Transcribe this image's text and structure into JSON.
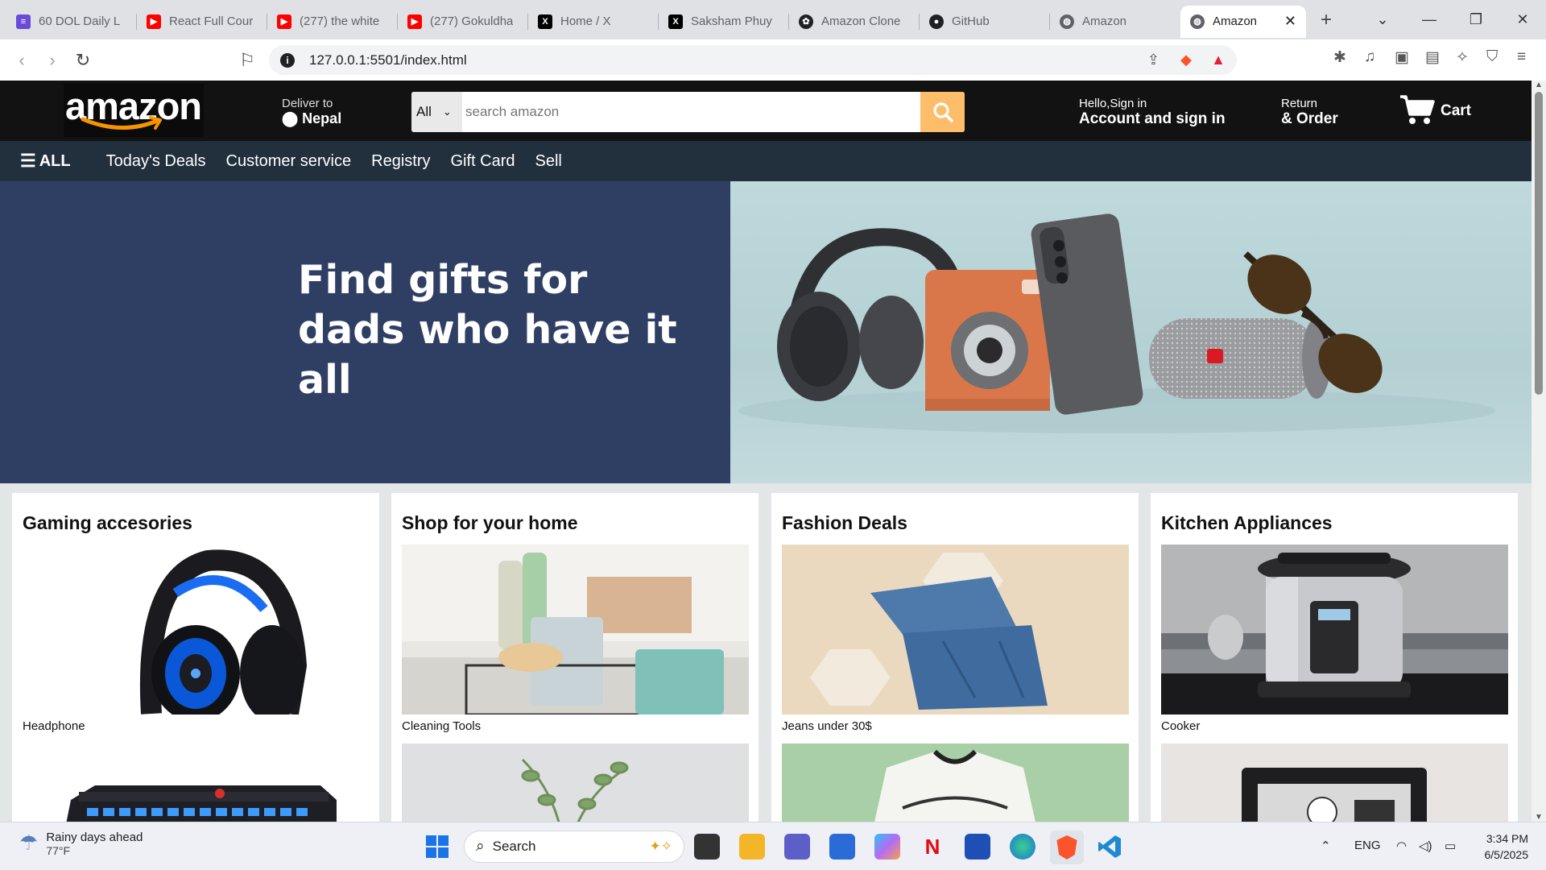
{
  "browser": {
    "tabs": [
      {
        "label": "60 DOL Daily L",
        "icon": "list-icon",
        "color": "#6a4bd8"
      },
      {
        "label": "React Full Cour",
        "icon": "youtube-icon",
        "color": "#ff0000"
      },
      {
        "label": "(277) the white",
        "icon": "youtube-icon",
        "color": "#ff0000"
      },
      {
        "label": "(277) Gokuldha",
        "icon": "youtube-icon",
        "color": "#ff0000"
      },
      {
        "label": "Home / X",
        "icon": "x-icon",
        "color": "#000000"
      },
      {
        "label": "Saksham Phuy",
        "icon": "x-icon",
        "color": "#000000"
      },
      {
        "label": "Amazon Clone",
        "icon": "openai-icon",
        "color": "#202124"
      },
      {
        "label": "GitHub",
        "icon": "github-icon",
        "color": "#202124"
      },
      {
        "label": "Amazon",
        "icon": "globe-icon",
        "color": "#5f6368"
      },
      {
        "label": "Amazon",
        "icon": "globe-icon",
        "color": "#5f6368",
        "active": true
      }
    ],
    "url": "127.0.0.1:5501/index.html"
  },
  "header": {
    "logo_text": "amazon",
    "deliver_small": "Deliver to",
    "deliver_location": "Nepal",
    "search_category": "All",
    "search_placeholder": "search amazon",
    "account_small": "Hello,Sign in",
    "account_big": "Account and sign in",
    "returns_small": "Return",
    "returns_big": "& Order",
    "cart_label": "Cart"
  },
  "nav": {
    "all_label": "ALL",
    "items": [
      "Today's Deals",
      "Customer service",
      "Registry",
      "Gift Card",
      "Sell"
    ]
  },
  "hero": {
    "line1": "Find gifts for",
    "line2": "dads who have it all"
  },
  "cards": [
    {
      "title": "Gaming accesories",
      "caption": "Headphone"
    },
    {
      "title": "Shop for your home",
      "caption": "Cleaning Tools"
    },
    {
      "title": "Fashion Deals",
      "caption": "Jeans under 30$"
    },
    {
      "title": "Kitchen Appliances",
      "caption": "Cooker"
    }
  ],
  "taskbar": {
    "weather_line1": "Rainy days ahead",
    "weather_line2": "77°F",
    "search_label": "Search",
    "lang": "ENG",
    "time": "3:34 PM",
    "date": "6/5/2025"
  },
  "colors": {
    "amazon_dark": "#121212",
    "amazon_nav": "#222f3d",
    "search_button": "#febd69",
    "hero_left": "#2f3f64"
  }
}
